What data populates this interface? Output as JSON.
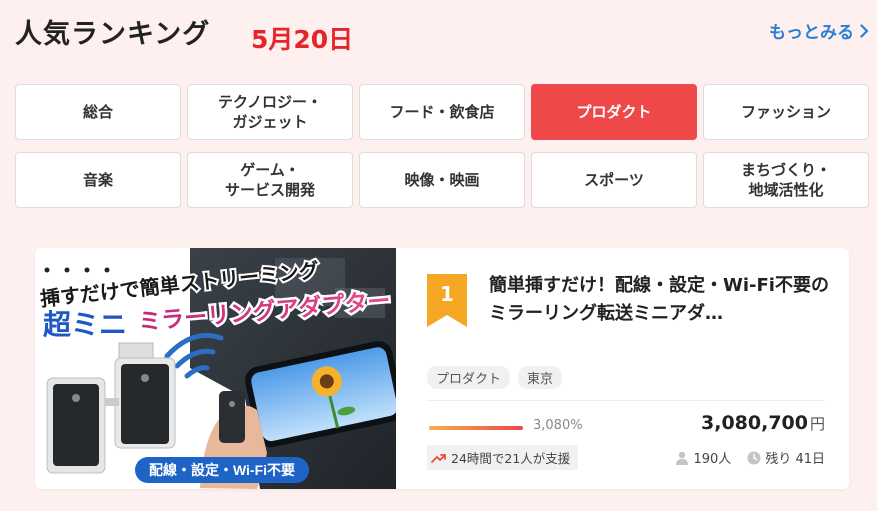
{
  "header": {
    "title": "人気ランキング",
    "date": "5月20日",
    "more_label": "もっとみる"
  },
  "categories": [
    {
      "label": "総合",
      "active": false
    },
    {
      "label": "テクノロジー・\nガジェット",
      "active": false
    },
    {
      "label": "フード・飲食店",
      "active": false
    },
    {
      "label": "プロダクト",
      "active": true
    },
    {
      "label": "ファッション",
      "active": false
    },
    {
      "label": "音楽",
      "active": false
    },
    {
      "label": "ゲーム・\nサービス開発",
      "active": false
    },
    {
      "label": "映像・映画",
      "active": false
    },
    {
      "label": "スポーツ",
      "active": false
    },
    {
      "label": "まちづくり・\n地域活性化",
      "active": false
    }
  ],
  "project": {
    "rank": "1",
    "title": "簡単挿すだけ！配線・設定・Wi-Fi不要のミラーリング転送ミニアダ…",
    "tags": [
      "プロダクト",
      "東京"
    ],
    "progress_percent": 3080,
    "percent_label": "3,080%",
    "amount": "3,080,700",
    "currency": "円",
    "trend_label": "24時間で21人が支援",
    "supporters": "190人",
    "remaining": "残り 41日",
    "image": {
      "headline_small": "挿すだけで簡単ストリーミング",
      "headline_big_1": "超ミニ",
      "headline_big_2": "ミラーリングアダプター",
      "footer_label": "配線・設定・Wi-Fi不要"
    }
  },
  "colors": {
    "accent_red": "#ef4848",
    "date_red": "#e8232a",
    "link_blue": "#2a7fd4",
    "badge_orange": "#f5a623",
    "background": "#fdf0ef"
  }
}
